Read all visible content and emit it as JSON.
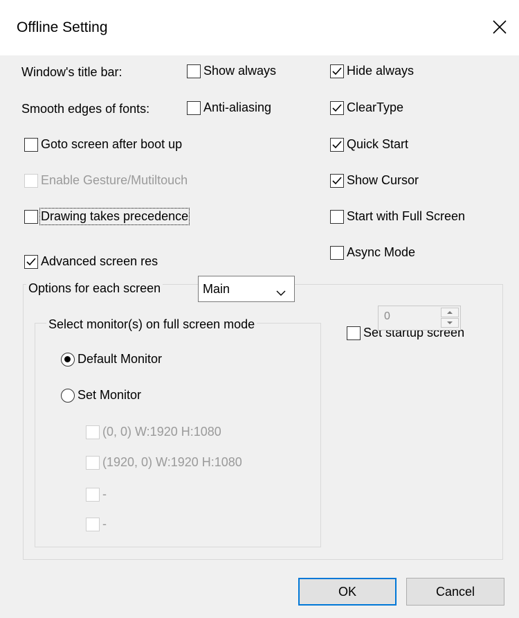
{
  "window": {
    "title": "Offline Setting",
    "close_icon": "close-icon"
  },
  "title_bar_setting": {
    "label": "Window's title bar:",
    "show_always": {
      "label": "Show always",
      "checked": false
    },
    "hide_always": {
      "label": "Hide always",
      "checked": true
    }
  },
  "smooth_fonts": {
    "label": "Smooth edges of fonts:",
    "anti_aliasing": {
      "label": "Anti-aliasing",
      "checked": false
    },
    "cleartype": {
      "label": "ClearType",
      "checked": true
    }
  },
  "options": {
    "goto_screen": {
      "label": "Goto screen after boot up",
      "checked": false
    },
    "enable_gesture": {
      "label": "Enable Gesture/Mutiltouch",
      "checked": false,
      "disabled": true
    },
    "drawing_precedence": {
      "label": "Drawing takes precedence",
      "checked": false
    },
    "advanced_screen_res": {
      "label": "Advanced screen res",
      "checked": true
    },
    "quick_start": {
      "label": "Quick Start",
      "checked": true
    },
    "show_cursor": {
      "label": "Show Cursor",
      "checked": true
    },
    "start_full_screen": {
      "label": "Start with Full Screen",
      "checked": false
    },
    "async_mode": {
      "label": "Async Mode",
      "checked": false
    }
  },
  "screen_options": {
    "label": "Options for each screen",
    "selected_screen": "Main",
    "startup_screen": {
      "label": "Set startup screen",
      "checked": false,
      "spin_value": "0"
    },
    "monitor_group": {
      "label": "Select monitor(s) on full screen mode",
      "default_monitor": {
        "label": "Default Monitor",
        "selected": true
      },
      "set_monitor": {
        "label": "Set Monitor",
        "selected": false
      },
      "monitors": [
        {
          "label": "(0, 0) W:1920 H:1080",
          "checked": false
        },
        {
          "label": "(1920, 0) W:1920 H:1080",
          "checked": false
        },
        {
          "label": "-",
          "checked": false
        },
        {
          "label": "-",
          "checked": false
        }
      ]
    }
  },
  "buttons": {
    "ok": "OK",
    "cancel": "Cancel"
  },
  "colors": {
    "accent": "#0078d7",
    "background": "#f0f0f0",
    "disabled_text": "#9a9a9a"
  }
}
